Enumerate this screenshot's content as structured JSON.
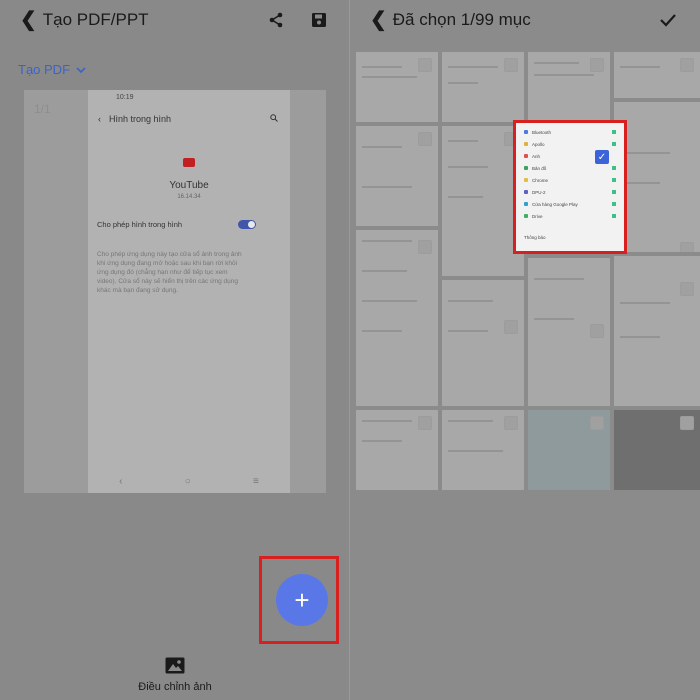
{
  "left": {
    "header": {
      "title": "Tạo PDF/PPT"
    },
    "dropdown_label": "Tạo PDF",
    "page_indicator": "1/1",
    "phone": {
      "status_time": "10:19",
      "header_title": "Hình trong hình",
      "app_name": "YouTube",
      "app_version": "16.14.34",
      "pip_label": "Cho phép hình trong hình",
      "pip_description": "Cho phép ứng dụng này tạo cửa sổ ảnh trong ảnh khi ứng dụng đang mở hoặc sau khi bạn rời khỏi ứng dụng đó (chẳng hạn như để tiếp tục xem video). Cửa sổ này sẽ hiển thị trên các ứng dụng khác mà bạn đang sử dụng."
    },
    "fab_label": "+",
    "adjust_label": "Điều chỉnh ảnh"
  },
  "right": {
    "header": {
      "title": "Đã chọn 1/99 mục"
    },
    "highlight_items": [
      "Bluetooth",
      "Apollo",
      "Anh",
      "Bản đồ",
      "Chrome",
      "DPU-2",
      "Cửa hàng Google Play",
      "Drive"
    ],
    "highlight_footer": "Thông báo"
  },
  "colors": {
    "accent": "#5977e6",
    "highlight_border": "#d92020",
    "overlay": "#8a8a8a"
  }
}
